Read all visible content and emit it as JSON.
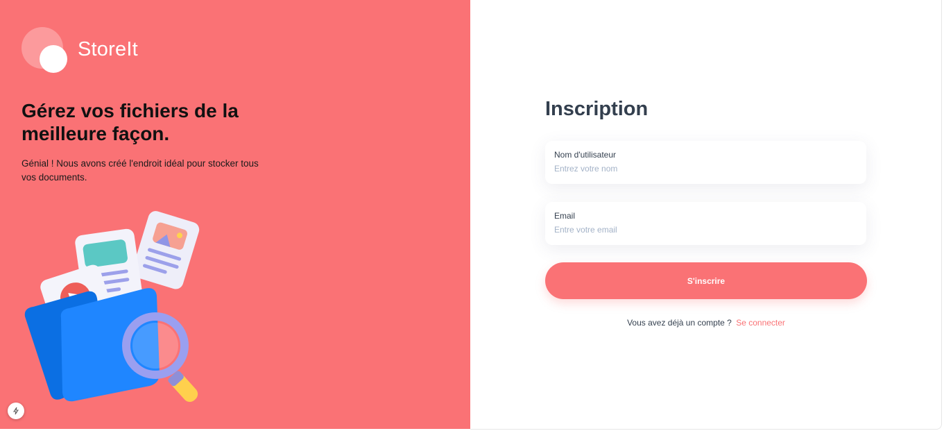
{
  "brand": {
    "name": "StoreIt",
    "primary_color": "#fa7275",
    "dark_text_color": "#333f4e"
  },
  "hero": {
    "headline": "Gérez vos fichiers de la meilleure façon.",
    "subtitle": "Génial ! Nous avons créé l'endroit idéal pour stocker tous vos documents.",
    "illustration": "folder-files-magnifier-illustration"
  },
  "form": {
    "title": "Inscription",
    "fields": [
      {
        "label": "Nom d'utilisateur",
        "placeholder": "Entrez votre nom",
        "value": ""
      },
      {
        "label": "Email",
        "placeholder": "Entre votre email",
        "value": ""
      }
    ],
    "submit_label": "S'inscrire",
    "switch_prompt": "Vous avez déjà un compte ?",
    "switch_link": "Se connecter"
  },
  "dev_badge_icon": "lightning-icon"
}
